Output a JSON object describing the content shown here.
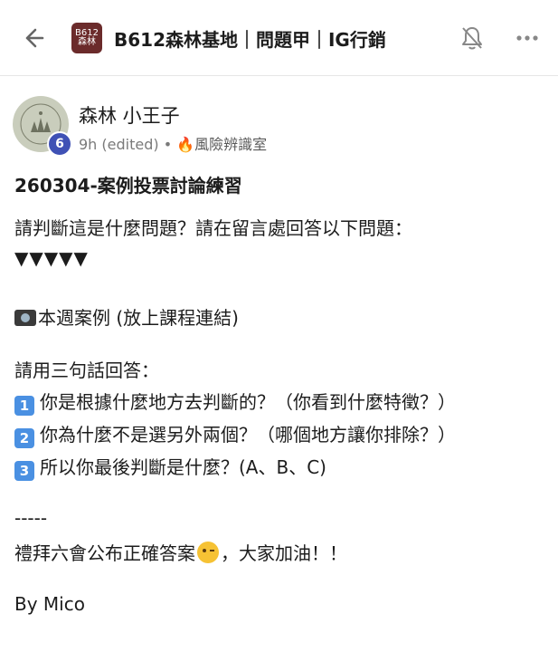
{
  "header": {
    "logo_line1": "B612",
    "logo_line2": "森林",
    "title": "B612森林基地｜問題甲｜IG行銷"
  },
  "post": {
    "author": "森林 小王子",
    "badge_count": "6",
    "time": "9h (edited)",
    "separator": " • ",
    "topic_icon": "🔥",
    "topic": "風險辨識室",
    "title": "260304-案例投票討論練習",
    "line1": "請判斷這是什麼問題？請在留言處回答以下問題：",
    "line2": "▼▼▼▼▼",
    "line3_text": "本週案例 (放上課程連結)",
    "line4": "請用三句話回答：",
    "q1_num": "1",
    "q1": "你是根據什麼地方去判斷的？（你看到什麼特徵？）",
    "q2_num": "2",
    "q2": "你為什麼不是選另外兩個？（哪個地方讓你排除？）",
    "q3_num": "3",
    "q3": "所以你最後判斷是什麼？(A、B、C)",
    "divider": "-----",
    "closing_a": "禮拜六會公布正確答案",
    "closing_b": "，大家加油！！",
    "signature": "By Mico"
  },
  "icons": [
    "back-arrow-icon",
    "bell-off-icon",
    "more-icon",
    "camera-icon",
    "fire-icon",
    "wink-emoji-icon"
  ],
  "colors": {
    "badge": "#3f51b5",
    "keycap": "#4a90e2",
    "logo": "#6b2b2b"
  }
}
